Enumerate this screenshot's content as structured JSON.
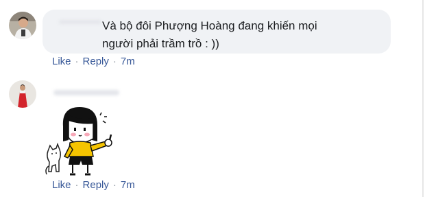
{
  "comments": [
    {
      "text": "Và bộ đôi Phượng Hoàng đang khiến mọi người phải trầm trồ : ))",
      "actions": {
        "like": "Like",
        "reply": "Reply",
        "time": "7m"
      }
    },
    {
      "sticker": "girl-pointing-with-cat-sticker",
      "actions": {
        "like": "Like",
        "reply": "Reply",
        "time": "7m"
      }
    }
  ],
  "colors": {
    "link": "#385898",
    "bubble": "#f0f2f5",
    "text": "#1c1e21",
    "separator": "#8d949e"
  }
}
